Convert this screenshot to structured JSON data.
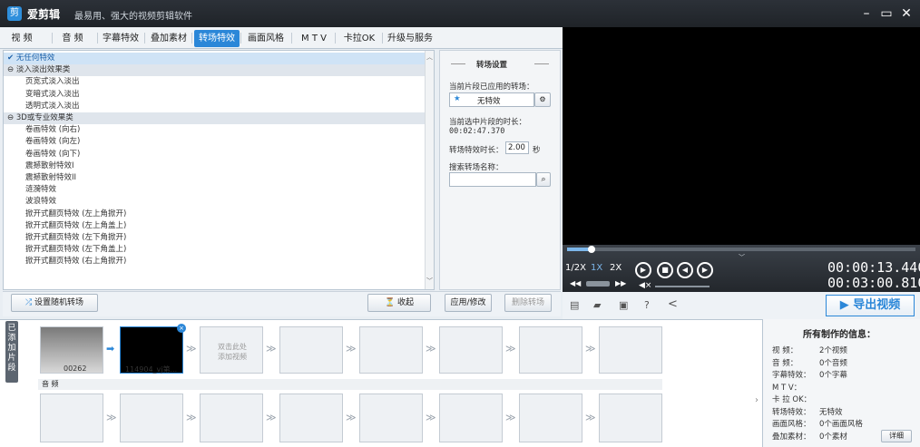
{
  "app": {
    "name": "爱剪辑",
    "slogan": "最易用、强大的视频剪辑软件",
    "logo": "剪"
  },
  "window_controls": [
    "–",
    "▭",
    "✕"
  ],
  "tabs": [
    "视 频",
    "音 频",
    "字幕特效",
    "叠加素材",
    "转场特效",
    "画面风格",
    "M T V",
    "卡拉OK",
    "升级与服务"
  ],
  "active_tab": 4,
  "effects_list": [
    {
      "label": "✔ 无任何特效",
      "type": "sel"
    },
    {
      "label": "⊖ 淡入淡出效果类",
      "type": "grp"
    },
    {
      "label": "页宽式淡入淡出",
      "type": "item"
    },
    {
      "label": "变暗式淡入淡出",
      "type": "item"
    },
    {
      "label": "透明式淡入淡出",
      "type": "item"
    },
    {
      "label": "⊖ 3D或专业效果类",
      "type": "grp"
    },
    {
      "label": "卷画特效 (向右)",
      "type": "item"
    },
    {
      "label": "卷画特效 (向左)",
      "type": "item"
    },
    {
      "label": "卷画特效 (向下)",
      "type": "item"
    },
    {
      "label": "震撼散射特效I",
      "type": "item"
    },
    {
      "label": "震撼散射特效II",
      "type": "item"
    },
    {
      "label": "涟漪特效",
      "type": "item"
    },
    {
      "label": "波浪特效",
      "type": "item"
    },
    {
      "label": "掀开式翻页特效 (左上角掀开)",
      "type": "item"
    },
    {
      "label": "掀开式翻页特效 (左上角盖上)",
      "type": "item"
    },
    {
      "label": "掀开式翻页特效 (左下角掀开)",
      "type": "item"
    },
    {
      "label": "掀开式翻页特效 (左下角盖上)",
      "type": "item"
    },
    {
      "label": "掀开式翻页特效 (右上角掀开)",
      "type": "item"
    }
  ],
  "settings": {
    "title": "转场设置",
    "applied_label": "当前片段已应用的转场：",
    "applied_value": "无特效",
    "duration_label": "当前选中片段的时长：",
    "duration_value": "00:02:47.370",
    "effect_duration_label": "转场特效时长：",
    "effect_duration_value": "2.00",
    "effect_duration_unit": "秒",
    "search_label": "搜索转场名称：",
    "search_value": ""
  },
  "buttons": {
    "random": "设置随机转场",
    "collapse": "收起",
    "apply": "应用/修改",
    "delete": "删除转场",
    "export": "导出视频"
  },
  "player": {
    "speed_options": [
      "1/2X",
      "1X",
      "2X"
    ],
    "current_time": "00:00:13.440",
    "total_time": "00:03:00.810",
    "progress": 0.07
  },
  "timeline": {
    "side_tab": "已添加片段",
    "clips": [
      {
        "label": "00262"
      },
      {
        "label": "114904_vj第..."
      }
    ],
    "add_hint": "双击此处\n添加视频",
    "audio_label": "音 频"
  },
  "info_panel": {
    "title": "所有制作的信息：",
    "rows": [
      {
        "k": "视    频：",
        "v": "2个视频"
      },
      {
        "k": "音    频：",
        "v": "0个音频"
      },
      {
        "k": "字幕特效：",
        "v": "0个字幕"
      },
      {
        "k": "M   T   V：",
        "v": ""
      },
      {
        "k": "卡 拉 OK：",
        "v": ""
      },
      {
        "k": "转场特效：",
        "v": "无特效"
      },
      {
        "k": "画面风格：",
        "v": "0个画面风格"
      },
      {
        "k": "叠加素材：",
        "v": "0个素材"
      }
    ],
    "detail_button": "详细"
  },
  "colors": {
    "accent": "#2b87d8",
    "titlebar": "#23272c",
    "preview": "#000000"
  }
}
